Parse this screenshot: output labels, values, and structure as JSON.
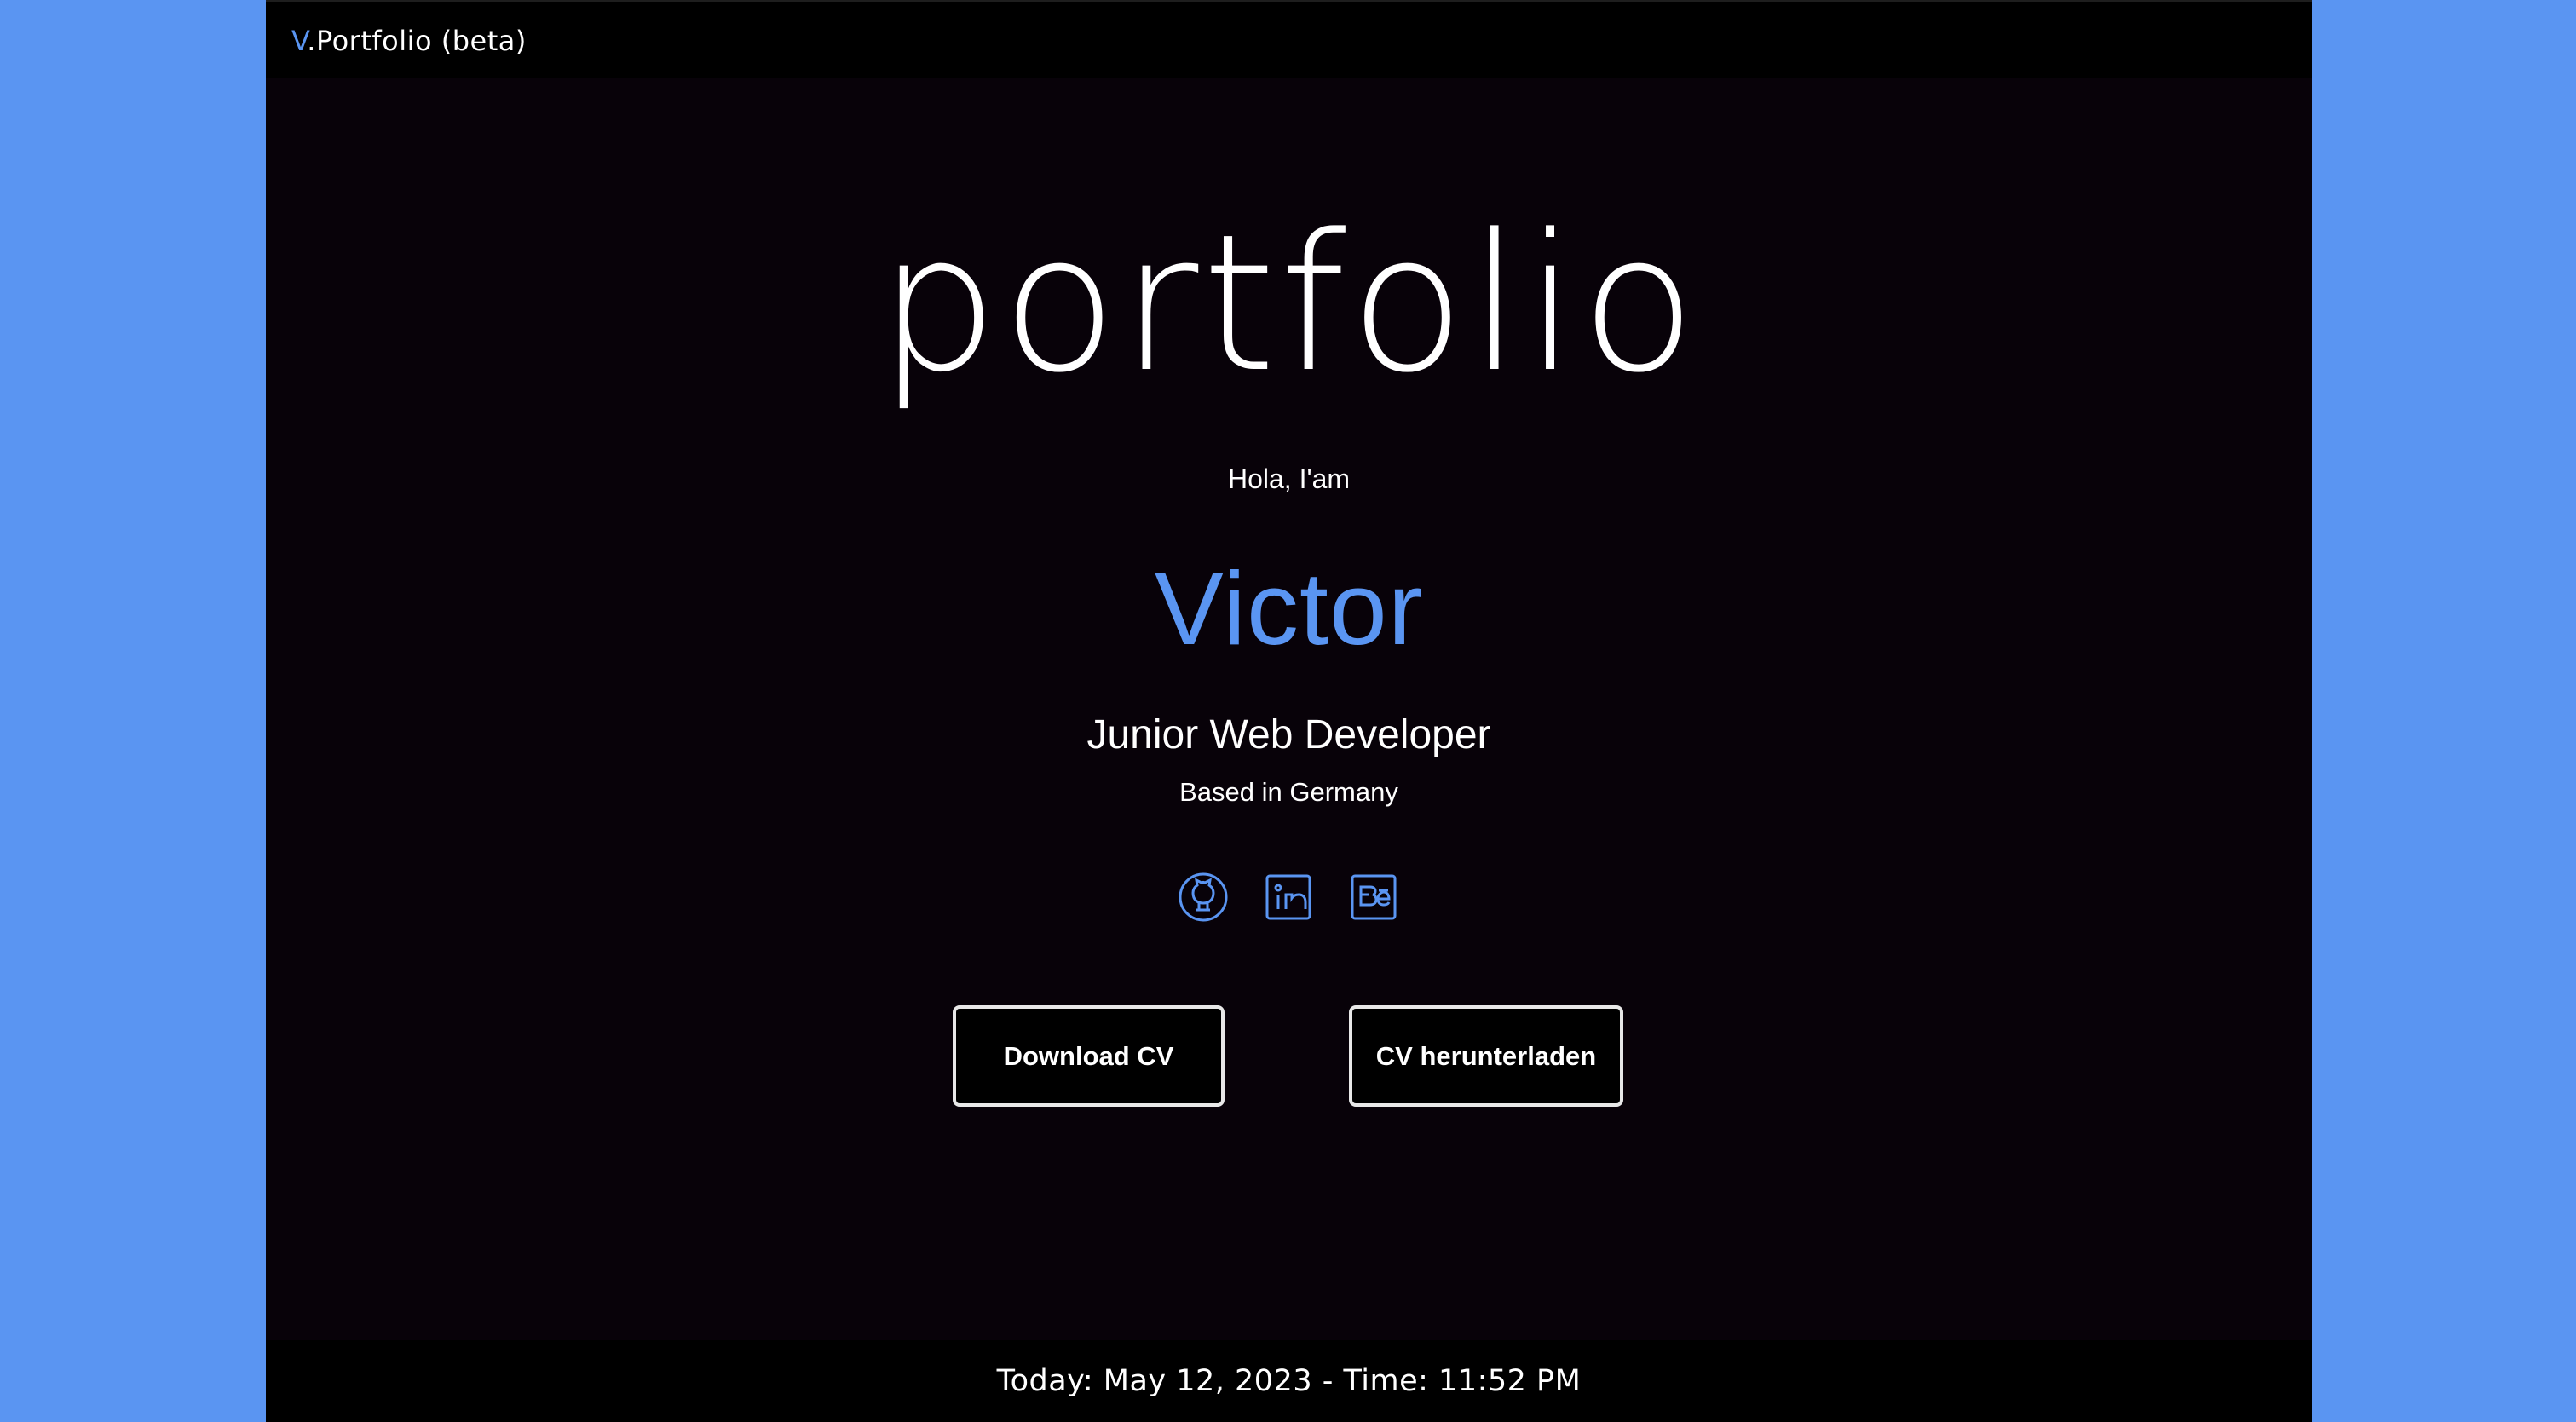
{
  "header": {
    "brand_prefix": "V",
    "brand_text": ".Portfolio (beta)"
  },
  "hero": {
    "title": "portfolio",
    "greeting": "Hola, I'am",
    "name": "Victor",
    "role": "Junior Web Developer",
    "location": "Based in Germany"
  },
  "social": {
    "github_icon": "github-icon",
    "linkedin_icon": "linkedin-icon",
    "behance_icon": "behance-icon",
    "icon_color": "#5a95f2"
  },
  "actions": {
    "download_cv": "Download CV",
    "cv_herunterladen": "CV herunterladen"
  },
  "footer": {
    "datetime": "Today: May 12, 2023 - Time: 11:52 PM"
  },
  "colors": {
    "background": "#5a95f2",
    "panel": "#080209",
    "accent": "#5a95f2",
    "text": "#ffffff"
  }
}
